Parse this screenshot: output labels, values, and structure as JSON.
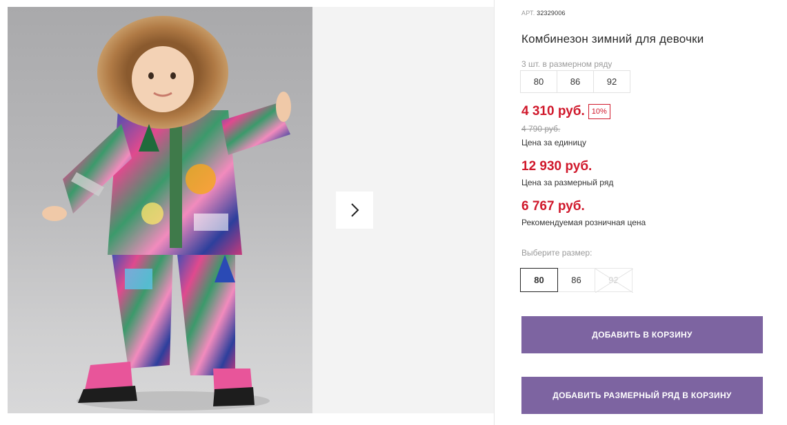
{
  "gallery": {
    "next_arrow_icon": "chevron-right-icon",
    "photo_alt": "Комбинезон зимний для девочки"
  },
  "product": {
    "sku_label": "АРТ.",
    "sku_number": "32329006",
    "title": "Комбинезон зимний для девочки",
    "row_note": "3 шт. в размерном ряду",
    "row_sizes": [
      "80",
      "86",
      "92"
    ]
  },
  "prices": {
    "unit_price": "4 310 руб.",
    "discount": "10%",
    "old_price": "4 790 руб.",
    "unit_caption": "Цена за единицу",
    "row_price": "12 930 руб.",
    "row_caption": "Цена за размерный ряд",
    "retail_price": "6 767 руб.",
    "retail_caption": "Рекомендуемая розничная цена"
  },
  "size_selector": {
    "label": "Выберите размер:",
    "options": [
      {
        "label": "80",
        "state": "selected"
      },
      {
        "label": "86",
        "state": "available"
      },
      {
        "label": "92",
        "state": "unavailable"
      }
    ]
  },
  "actions": {
    "add_to_cart": "ДОБАВИТЬ В КОРЗИНУ",
    "add_row_to_cart": "ДОБАВИТЬ РАЗМЕРНЫЙ РЯД В КОРЗИНУ"
  },
  "colors": {
    "accent_purple": "#7d64a1",
    "price_red": "#d0182b"
  }
}
